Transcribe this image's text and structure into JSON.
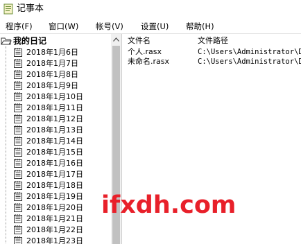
{
  "window": {
    "title": "记事本",
    "icon": "notepad-app-icon"
  },
  "menu": [
    {
      "label": "程序(F)"
    },
    {
      "label": "窗口(W)"
    },
    {
      "label": "帐号(V)"
    },
    {
      "label": "设置(U)"
    },
    {
      "label": "帮助(H)"
    }
  ],
  "tree": {
    "root_label": "我的日记",
    "root_icon": "folder-open-icon",
    "item_icon": "notebook-icon",
    "items": [
      "2018年1月6日",
      "2018年1月7日",
      "2018年1月8日",
      "2018年1月9日",
      "2018年1月10日",
      "2018年1月11日",
      "2018年1月12日",
      "2018年1月13日",
      "2018年1月14日",
      "2018年1月15日",
      "2018年1月16日",
      "2018年1月17日",
      "2018年1月18日",
      "2018年1月19日",
      "2018年1月20日",
      "2018年1月21日",
      "2018年1月22日",
      "2018年1月23日"
    ]
  },
  "files": {
    "columns": [
      "文件名",
      "文件路径"
    ],
    "rows": [
      {
        "name": "个人.rasx",
        "path": "C:\\Users\\Administrator\\Do"
      },
      {
        "name": "未命名.rasx",
        "path": "C:\\Users\\Administrator\\De"
      }
    ]
  },
  "watermark": "ifxdh.com",
  "colors": {
    "watermark": "#e8202a",
    "scrollbar_track": "#f0f0f0",
    "scrollbar_thumb": "#c1c1c1"
  }
}
